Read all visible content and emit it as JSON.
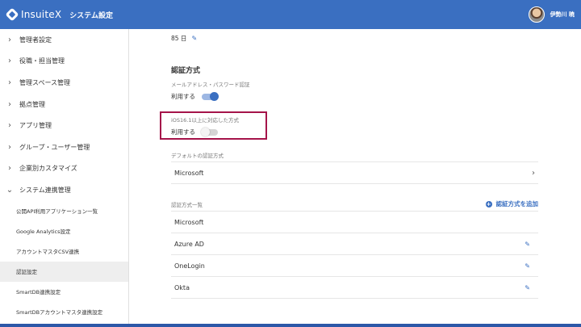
{
  "header": {
    "brand": "InsuiteX",
    "page_title": "システム設定",
    "user_name": "伊勢川 暁",
    "accent_color": "#3a6fc1"
  },
  "sidebar": {
    "items": [
      {
        "label": "管理者設定",
        "icon": "chevron-right-icon"
      },
      {
        "label": "役職・担当管理",
        "icon": "chevron-right-icon"
      },
      {
        "label": "管理スペース管理",
        "icon": "chevron-right-icon"
      },
      {
        "label": "拠点管理",
        "icon": "chevron-right-icon"
      },
      {
        "label": "アプリ管理",
        "icon": "chevron-right-icon"
      },
      {
        "label": "グループ・ユーザー管理",
        "icon": "chevron-right-icon"
      },
      {
        "label": "企業別カスタマイズ",
        "icon": "chevron-right-icon"
      },
      {
        "label": "システム連携管理",
        "icon": "chevron-down-icon"
      }
    ],
    "sub_items": [
      {
        "label": "公開API利用アプリケーション一覧"
      },
      {
        "label": "Google Analytics設定"
      },
      {
        "label": "アカウントマスタCSV連携"
      },
      {
        "label": "認証設定",
        "active": true
      },
      {
        "label": "SmartDB連携設定"
      },
      {
        "label": "SmartDBアカウントマスタ連携設定"
      }
    ]
  },
  "main": {
    "days_value": "85 日",
    "section_title": "認証方式",
    "email_auth": {
      "label": "メールアドレス・パスワード認証",
      "status": "利用する",
      "enabled": true
    },
    "ios_auth": {
      "label": "iOS16.1以上に対応した方式",
      "status": "利用する",
      "enabled": false
    },
    "default_method": {
      "label": "デフォルトの認証方式",
      "value": "Microsoft"
    },
    "method_list": {
      "label": "認証方式一覧",
      "add_label": "認証方式を追加",
      "items": [
        {
          "name": "Microsoft",
          "editable": false
        },
        {
          "name": "Azure AD",
          "editable": true
        },
        {
          "name": "OneLogin",
          "editable": true
        },
        {
          "name": "Okta",
          "editable": true
        }
      ]
    }
  }
}
